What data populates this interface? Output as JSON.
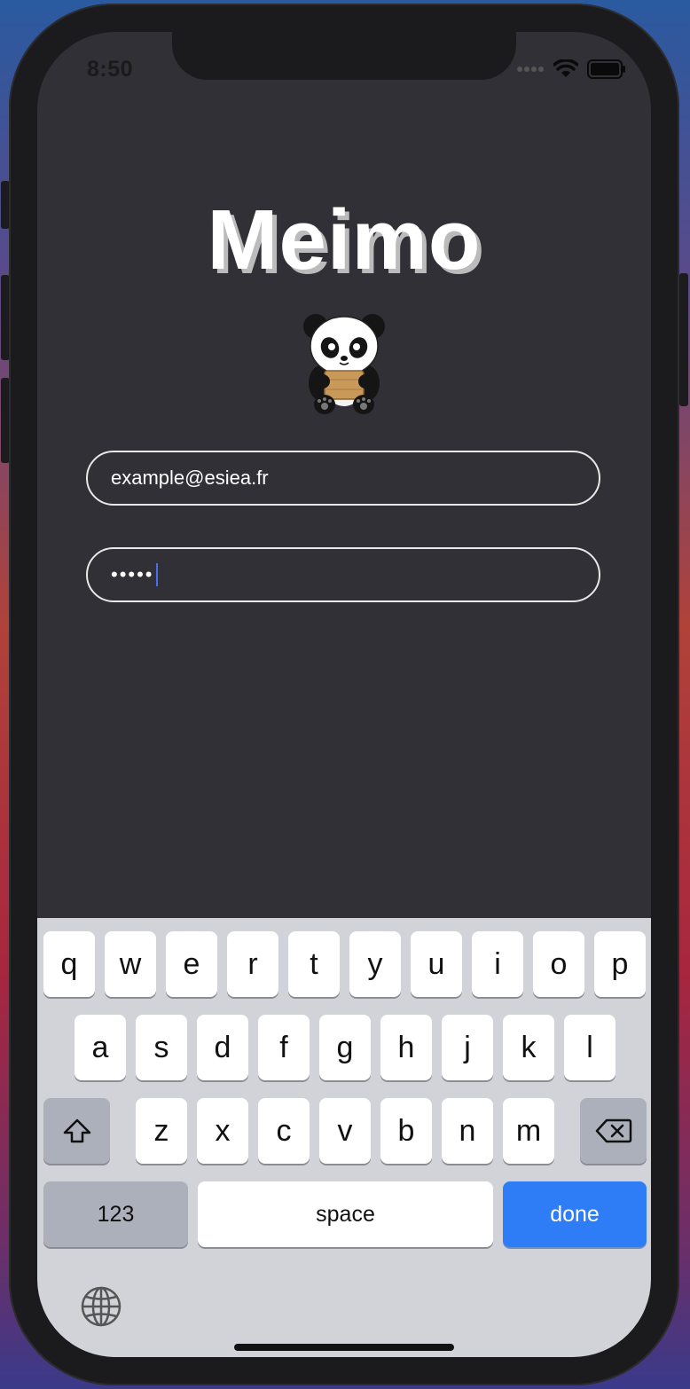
{
  "status_bar": {
    "time": "8:50",
    "signal_icon": "signal-dots-icon",
    "wifi_icon": "wifi-icon",
    "battery_icon": "battery-icon"
  },
  "app": {
    "title": "Meimo",
    "mascot_icon": "panda-icon"
  },
  "form": {
    "email": {
      "value": "example@esiea.fr"
    },
    "password": {
      "value": "•••••"
    }
  },
  "keyboard": {
    "row1": [
      "q",
      "w",
      "e",
      "r",
      "t",
      "y",
      "u",
      "i",
      "o",
      "p"
    ],
    "row2": [
      "a",
      "s",
      "d",
      "f",
      "g",
      "h",
      "j",
      "k",
      "l"
    ],
    "row3": [
      "z",
      "x",
      "c",
      "v",
      "b",
      "n",
      "m"
    ],
    "numbers_label": "123",
    "space_label": "space",
    "done_label": "done",
    "shift_icon": "shift-icon",
    "delete_icon": "delete-icon",
    "globe_icon": "globe-icon"
  },
  "colors": {
    "done_key": "#2f7df6",
    "screen_bg": "#303036",
    "keyboard_bg": "#d1d3d9"
  }
}
